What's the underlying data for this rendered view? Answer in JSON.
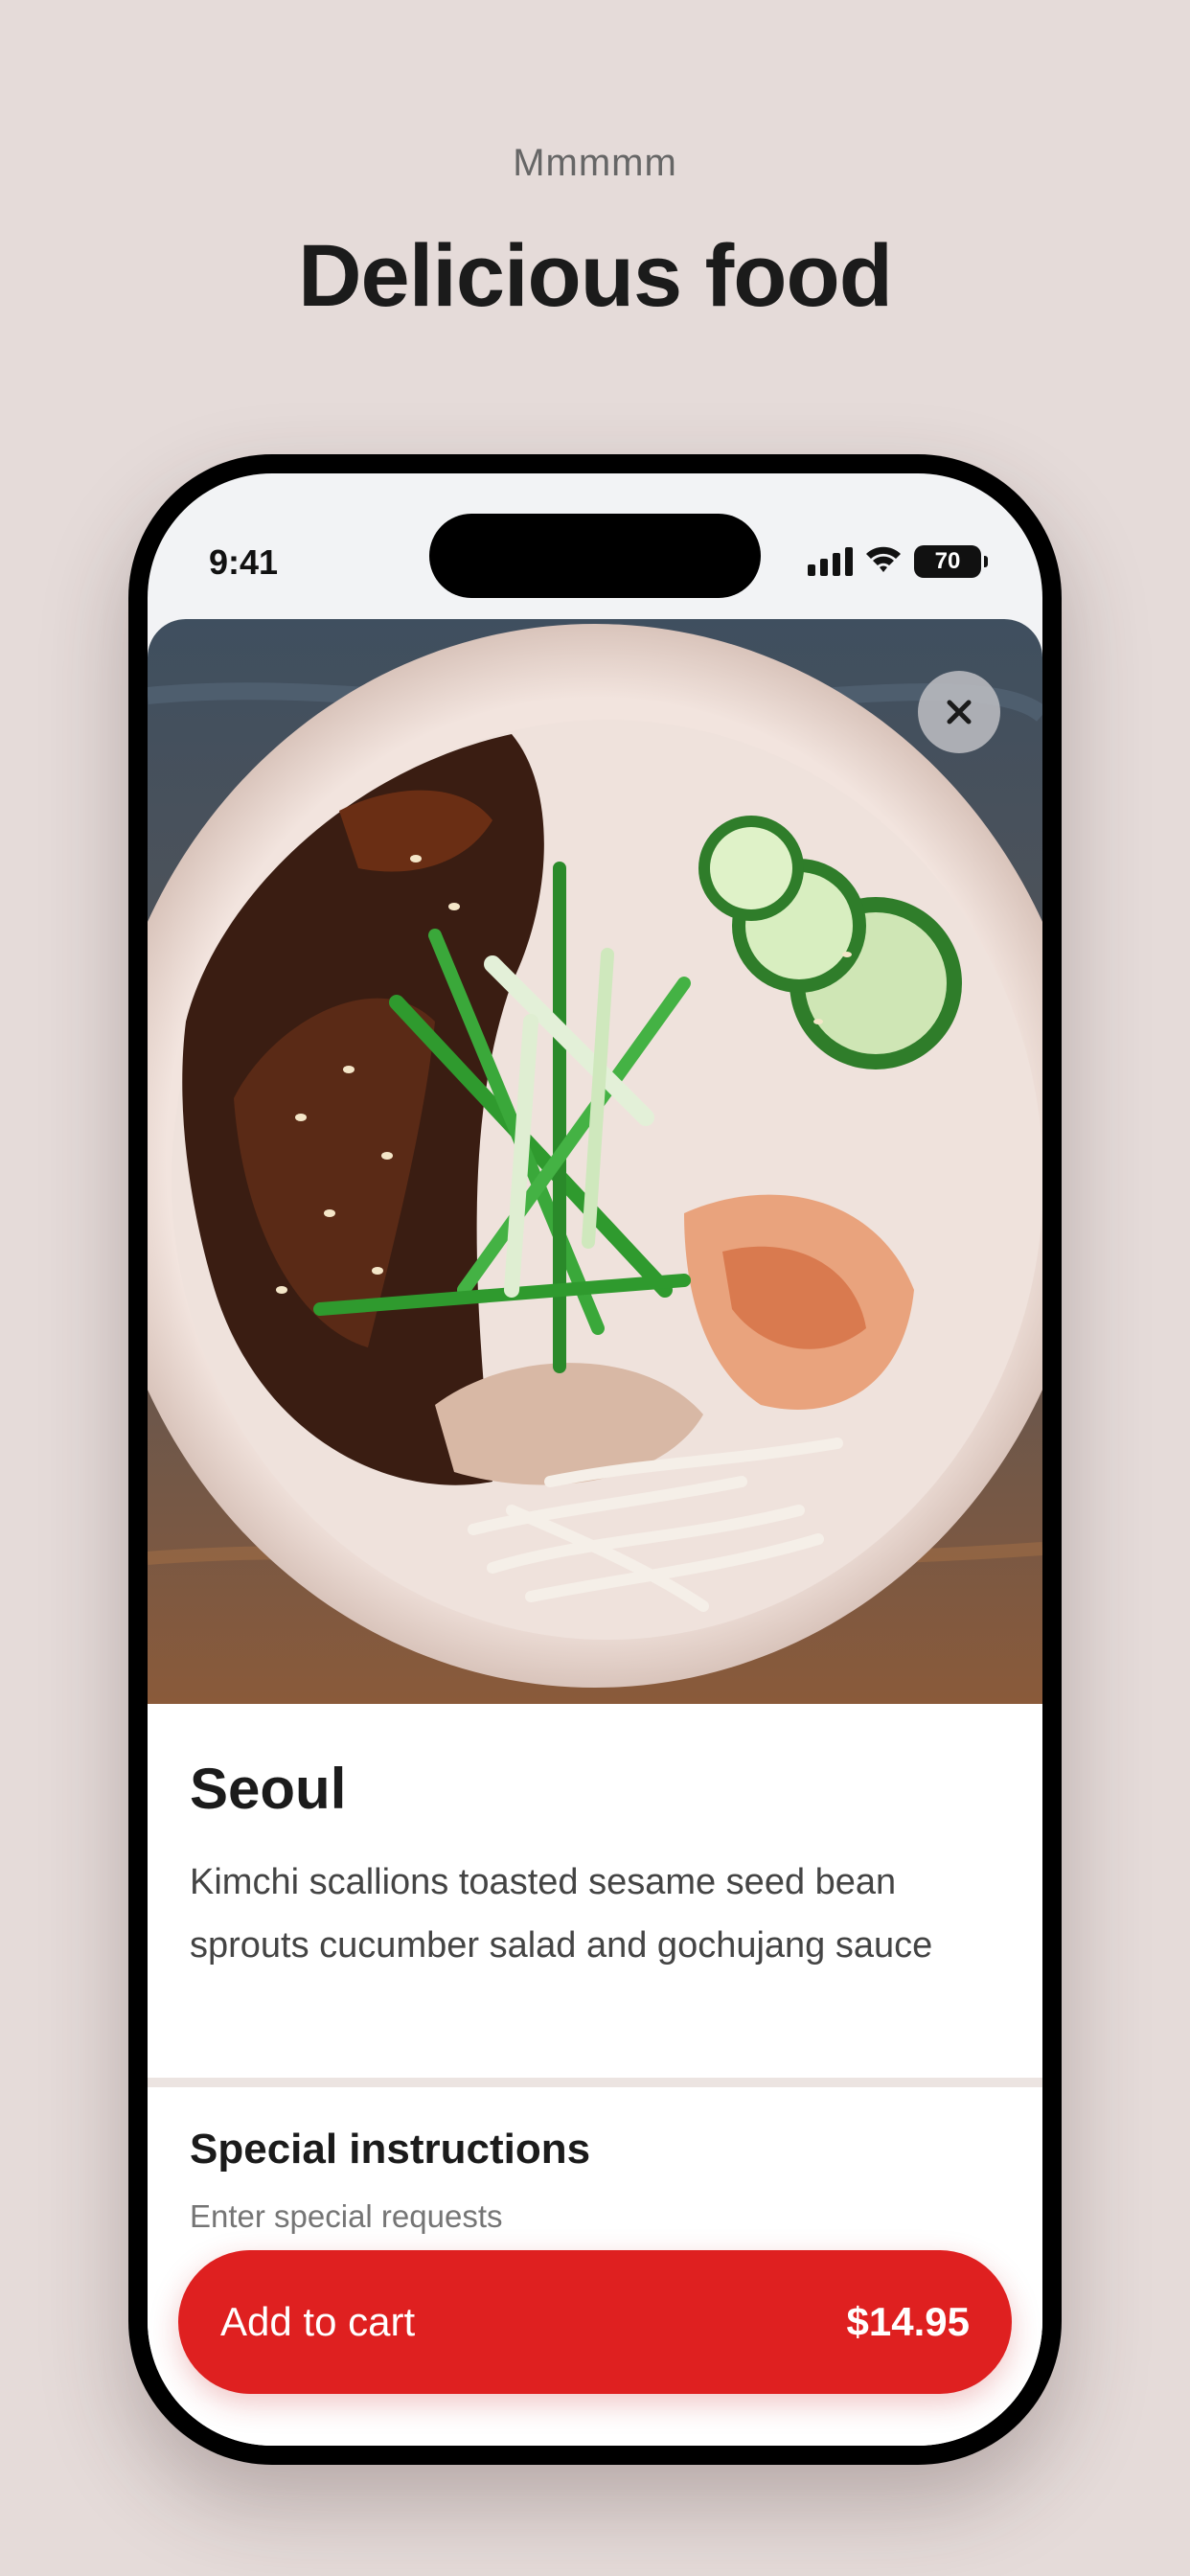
{
  "page": {
    "eyebrow": "Mmmmm",
    "headline": "Delicious food"
  },
  "status_bar": {
    "time": "9:41",
    "battery": "70"
  },
  "item": {
    "image_icon": "food-bowl-photo",
    "close_icon": "close-icon",
    "title": "Seoul",
    "description": "Kimchi scallions toasted sesame seed bean sprouts cucumber salad and gochujang sauce"
  },
  "special_instructions": {
    "title": "Special instructions",
    "placeholder": "Enter special requests"
  },
  "cart_button": {
    "label": "Add to cart",
    "price": "$14.95"
  },
  "colors": {
    "background": "#e5dbd9",
    "accent": "#df2020"
  }
}
